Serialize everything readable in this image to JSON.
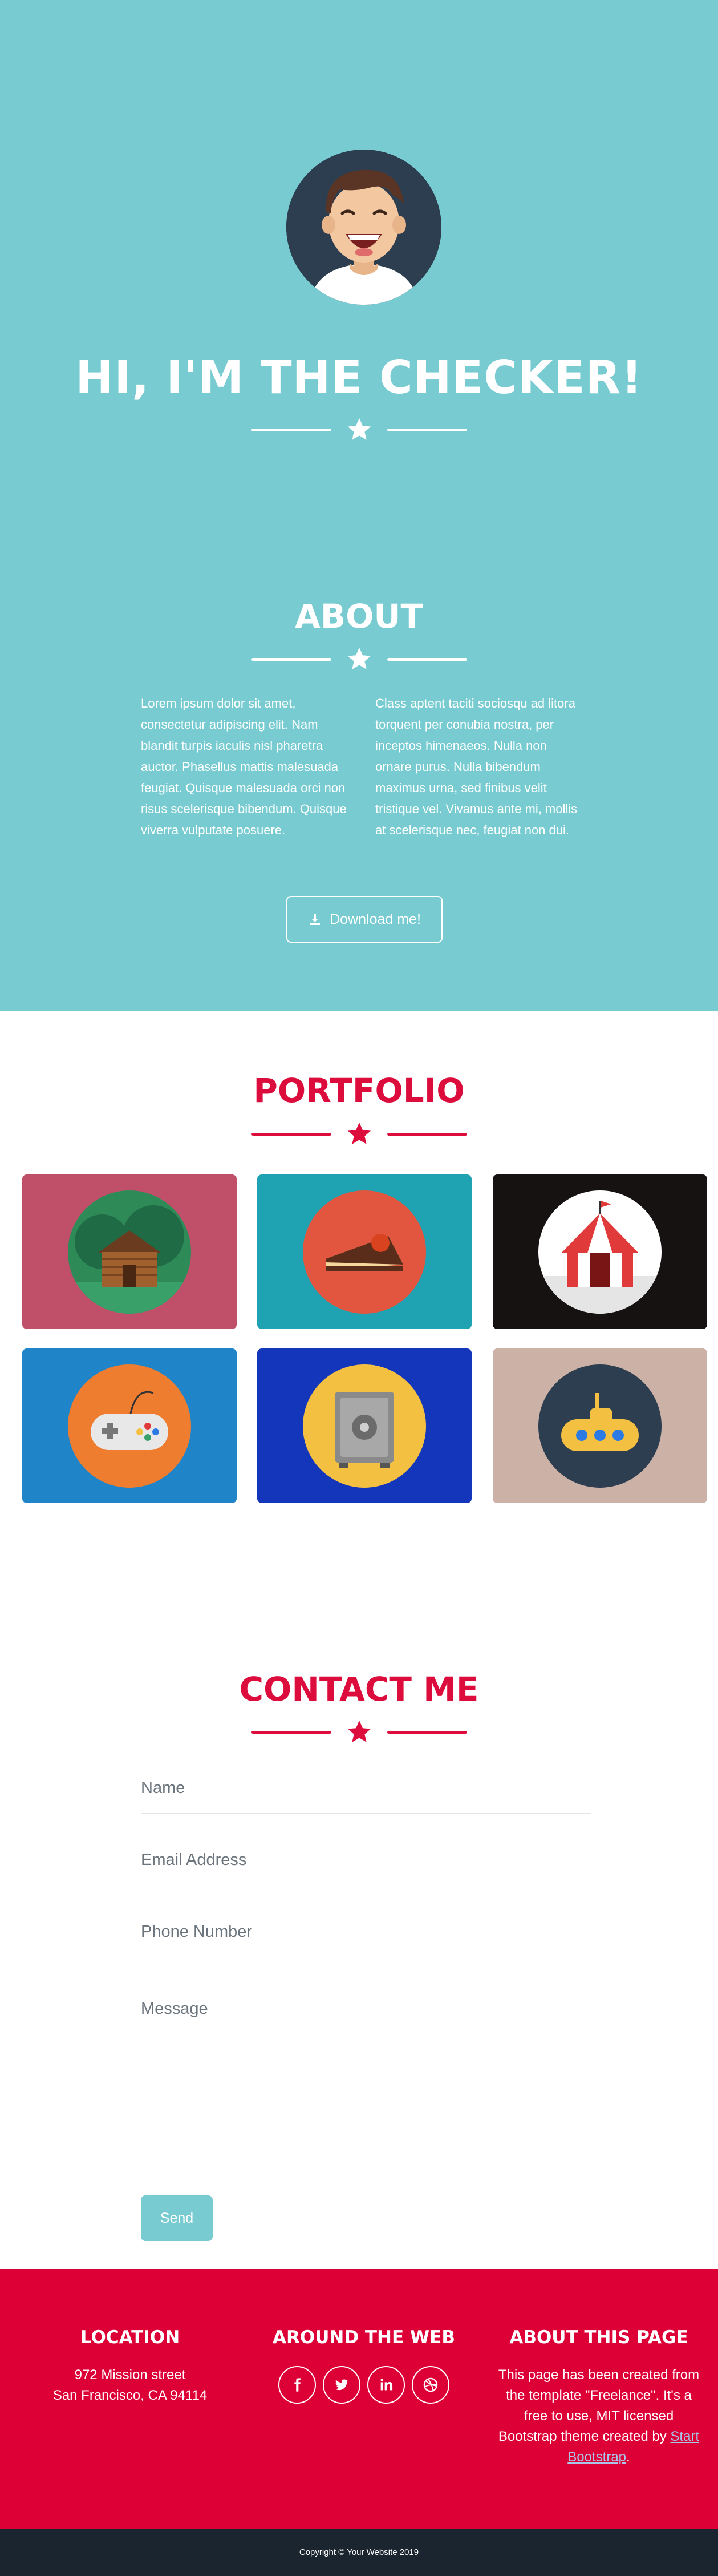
{
  "colors": {
    "primary": "#78ccd1",
    "accent": "#dc0d3d",
    "footer": "#dc0037",
    "dark": "#1a252f"
  },
  "masthead": {
    "title": "HI, I'M THE CHECKER!",
    "avatar_icon": "smiling-person-avatar",
    "divider_icon": "star-icon"
  },
  "about": {
    "title": "ABOUT",
    "left_text": "Lorem ipsum dolor sit amet, consectetur adipiscing elit. Nam blandit turpis iaculis nisl pharetra auctor. Phasellus mattis malesuada feugiat. Quisque malesuada orci non risus scelerisque bibendum. Quisque viverra vulputate posuere.",
    "right_text": "Class aptent taciti sociosqu ad litora torquent per conubia nostra, per inceptos himenaeos. Nulla non ornare purus. Nulla bibendum maximus urna, sed finibus velit tristique vel. Vivamus ante mi, mollis at scelerisque nec, feugiat non dui.",
    "download_label": "Download me!",
    "download_icon": "download-icon"
  },
  "portfolio": {
    "title": "PORTFOLIO",
    "items": [
      {
        "name": "cabin",
        "bg": "#c0506a",
        "disc": "#2e8b57"
      },
      {
        "name": "cake",
        "bg": "#1fa3b3",
        "disc": "#e2563f"
      },
      {
        "name": "circus",
        "bg": "#161212",
        "disc": "#ffffff"
      },
      {
        "name": "game-controller",
        "bg": "#1f84c8",
        "disc": "#ee7d2f"
      },
      {
        "name": "safe",
        "bg": "#1436bb",
        "disc": "#f3c042"
      },
      {
        "name": "submarine",
        "bg": "#ccb2a6",
        "disc": "#2c3e50"
      }
    ]
  },
  "contact": {
    "title": "CONTACT ME",
    "name_placeholder": "Name",
    "email_placeholder": "Email Address",
    "phone_placeholder": "Phone Number",
    "message_placeholder": "Message",
    "send_label": "Send"
  },
  "footer": {
    "location_title": "LOCATION",
    "location_line1": "972 Mission street",
    "location_line2": "San Francisco, CA 94114",
    "web_title": "AROUND THE WEB",
    "social": [
      "facebook-icon",
      "twitter-icon",
      "linkedin-icon",
      "dribbble-icon"
    ],
    "about_title": "ABOUT THIS PAGE",
    "about_text": "This page has been created from the template \"Freelance\". It's a free to use, MIT licensed Bootstrap theme created by",
    "about_link": "Start Bootstrap",
    "about_end": "."
  },
  "copyright": "Copyright © Your Website 2019"
}
